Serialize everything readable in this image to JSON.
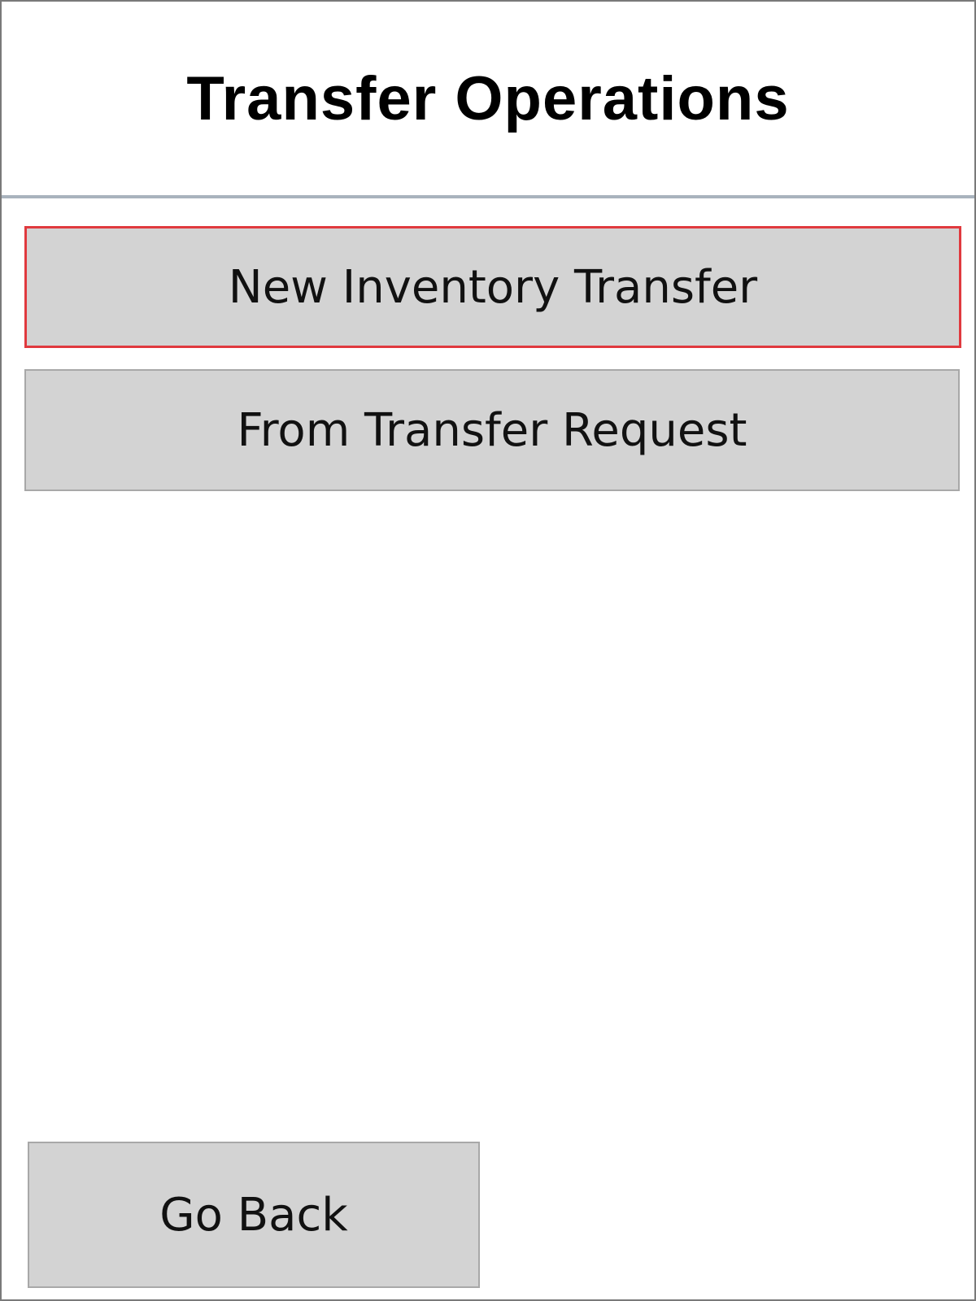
{
  "header": {
    "title": "Transfer Operations"
  },
  "menu": {
    "items": [
      {
        "label": "New Inventory Transfer",
        "selected": true
      },
      {
        "label": "From Transfer Request",
        "selected": false
      }
    ]
  },
  "footer": {
    "back_label": "Go Back"
  },
  "colors": {
    "button_bg": "#d3d3d3",
    "selection_border": "#e0393e",
    "divider": "#a9b3bd"
  }
}
